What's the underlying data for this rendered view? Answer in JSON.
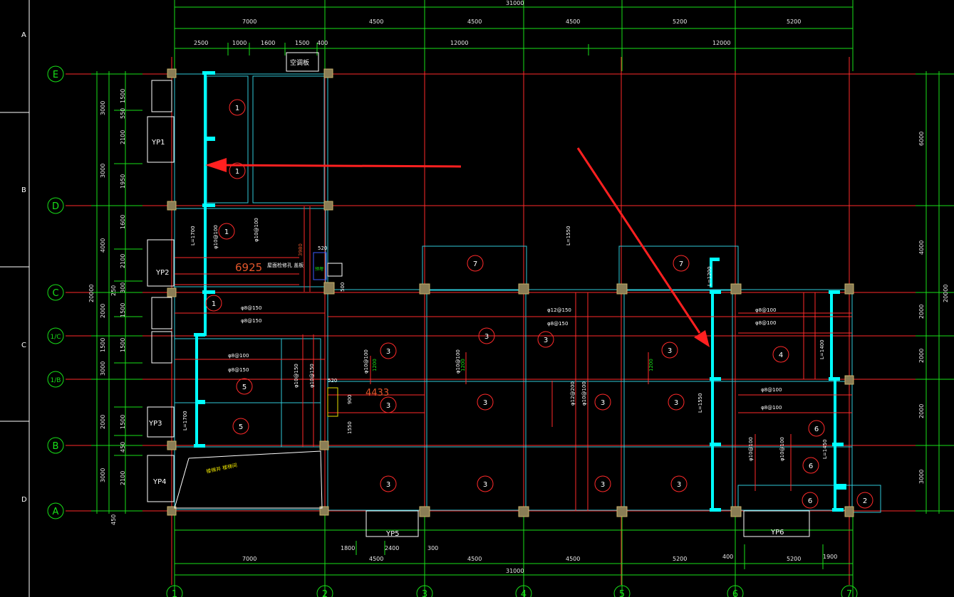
{
  "side_markers": [
    "A",
    "B",
    "C",
    "D"
  ],
  "grid": {
    "cols": [
      "1",
      "2",
      "3",
      "4",
      "5",
      "6",
      "7"
    ],
    "rows": [
      "E",
      "D",
      "C",
      "1/C",
      "1/B",
      "B",
      "A"
    ]
  },
  "dims": {
    "top_total": "31000",
    "top_major": [
      "7000",
      "4500",
      "4500",
      "4500",
      "5200",
      "5200"
    ],
    "top_sub": [
      "2500",
      "1000",
      "1600",
      "1500",
      "400",
      "12000",
      "12000"
    ],
    "bottom_total": "31000",
    "bottom_major": [
      "7000",
      "4500",
      "4500",
      "4500",
      "5200",
      "5200"
    ],
    "bottom_sub": [
      "1800",
      "2400",
      "300",
      "400",
      "1900"
    ],
    "left": [
      "3000",
      "3000",
      "4000",
      "2000",
      "1500",
      "3000",
      "2000",
      "3000",
      "20000",
      "450"
    ],
    "left_sub": [
      "1500",
      "550",
      "2100",
      "1950",
      "1600",
      "2100",
      "300",
      "1500",
      "1500",
      "1500",
      "450",
      "2100",
      "250"
    ],
    "right": [
      "6000",
      "4000",
      "2000",
      "2000",
      "2000",
      "3000",
      "20000"
    ]
  },
  "labels": {
    "yp": [
      "YP1",
      "YP2",
      "YP3",
      "YP4",
      "YP5",
      "YP6"
    ],
    "aircon": "空调板",
    "zone_nums": [
      "1",
      "1",
      "1",
      "1",
      "7",
      "7",
      "3",
      "3",
      "3",
      "3",
      "4",
      "5",
      "5",
      "3",
      "3",
      "3",
      "3",
      "3",
      "3",
      "3",
      "6",
      "6",
      "6",
      "2",
      "3",
      "3",
      "3",
      "3"
    ],
    "red_big": [
      "6925",
      "4433"
    ],
    "rebar": [
      "φ8@150",
      "φ8@150",
      "φ8@100",
      "φ8@150",
      "φ12@150",
      "φ8@150",
      "φ8@100",
      "φ8@100",
      "φ8@100",
      "φ8@100",
      "φ10@100",
      "φ10@100",
      "φ10@100",
      "φ10@100",
      "φ12@200",
      "φ10@100",
      "φ10@150",
      "φ10@150",
      "φ10@100",
      "φ10@100"
    ],
    "small_dims": [
      "520",
      "520",
      "900",
      "1550",
      "500",
      "3980",
      "1200",
      "1200",
      "1200"
    ],
    "wall_len": [
      "L=1700",
      "L=1700",
      "L=1550",
      "L=1450",
      "L=1400",
      "L=1200",
      "L=1550"
    ],
    "note_yellow": "楼梯井 楼梯间",
    "stair_text": "屋面检修孔 盖板",
    "green_sub": "预埋"
  },
  "colors": {
    "background": "#000000",
    "grid_line": "#ff2a2a",
    "dim_line": "#18e018",
    "wall": "#00ffff",
    "column": "#8a7d55",
    "text": "#ffffff",
    "arrow": "#ff2020",
    "accent_yellow": "#e8e000"
  }
}
